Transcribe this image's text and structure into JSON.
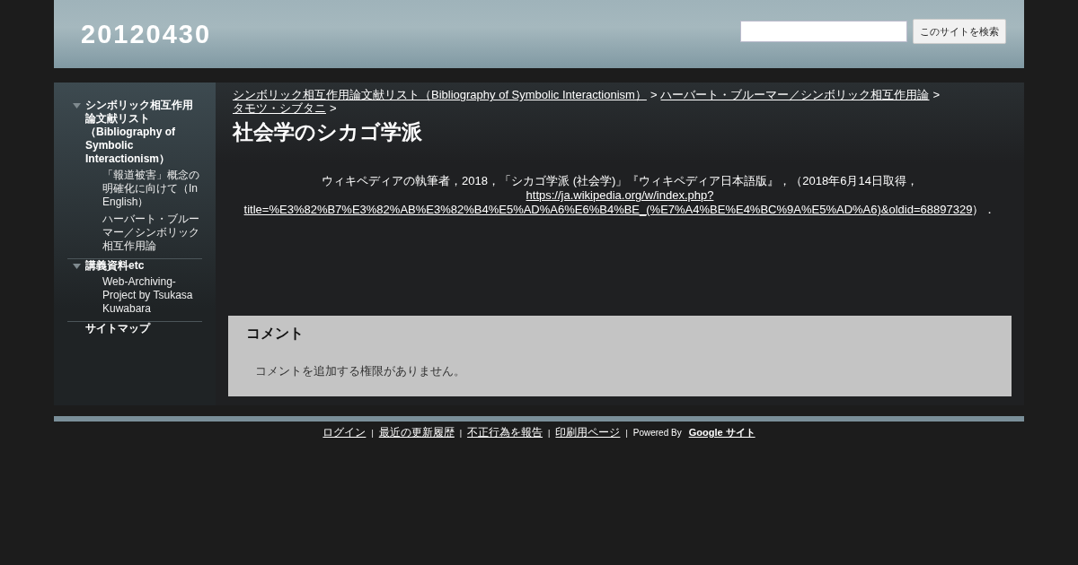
{
  "header": {
    "site_title": "20120430",
    "search": {
      "button": "このサイトを検索"
    }
  },
  "sidebar": {
    "items": [
      {
        "label": "シンボリック相互作用論文献リスト（Bibliography of Symbolic Interactionism）",
        "expanded": true,
        "children": [
          {
            "label": "「報道被害」概念の明確化に向けて（In English）"
          },
          {
            "label": "ハーバート・ブルーマー／シンボリック相互作用論"
          }
        ]
      },
      {
        "label": "講義資料etc",
        "expanded": true,
        "children": [
          {
            "label": "Web-Archiving-Project by Tsukasa Kuwabara"
          }
        ]
      },
      {
        "label": "サイトマップ"
      }
    ]
  },
  "breadcrumbs": {
    "separator": ">",
    "items": [
      {
        "label": "シンボリック相互作用論文献リスト（Bibliography of Symbolic Interactionism）"
      },
      {
        "label": "ハーバート・ブルーマー／シンボリック相互作用論"
      },
      {
        "label": "タモツ・シブタニ"
      }
    ]
  },
  "page_title": "社会学のシカゴ学派",
  "citation": {
    "text_before": "ウィキペディアの執筆者，2018，「シカゴ学派 (社会学)」『ウィキペディア日本語版』，（2018年6月14日取得，",
    "link_parts": [
      "https://ja.wikipedia.org/w/index.php?",
      "title=%E3%82%B7%E3%82%AB%E3%82%B4%E5%AD%A6%E6%B4%BE_(%E7%A4%BE%E4%BC%9A%E5%AD%A6)&oldid=68897329"
    ],
    "text_after": "）．"
  },
  "comments": {
    "heading": "コメント",
    "message": "コメントを追加する権限がありません。"
  },
  "footer": {
    "separator": "|",
    "links": [
      "ログイン",
      "最近の更新履歴",
      "不正行為を報告",
      "印刷用ページ"
    ],
    "powered_by": "Powered By",
    "brand": "Google サイト"
  }
}
